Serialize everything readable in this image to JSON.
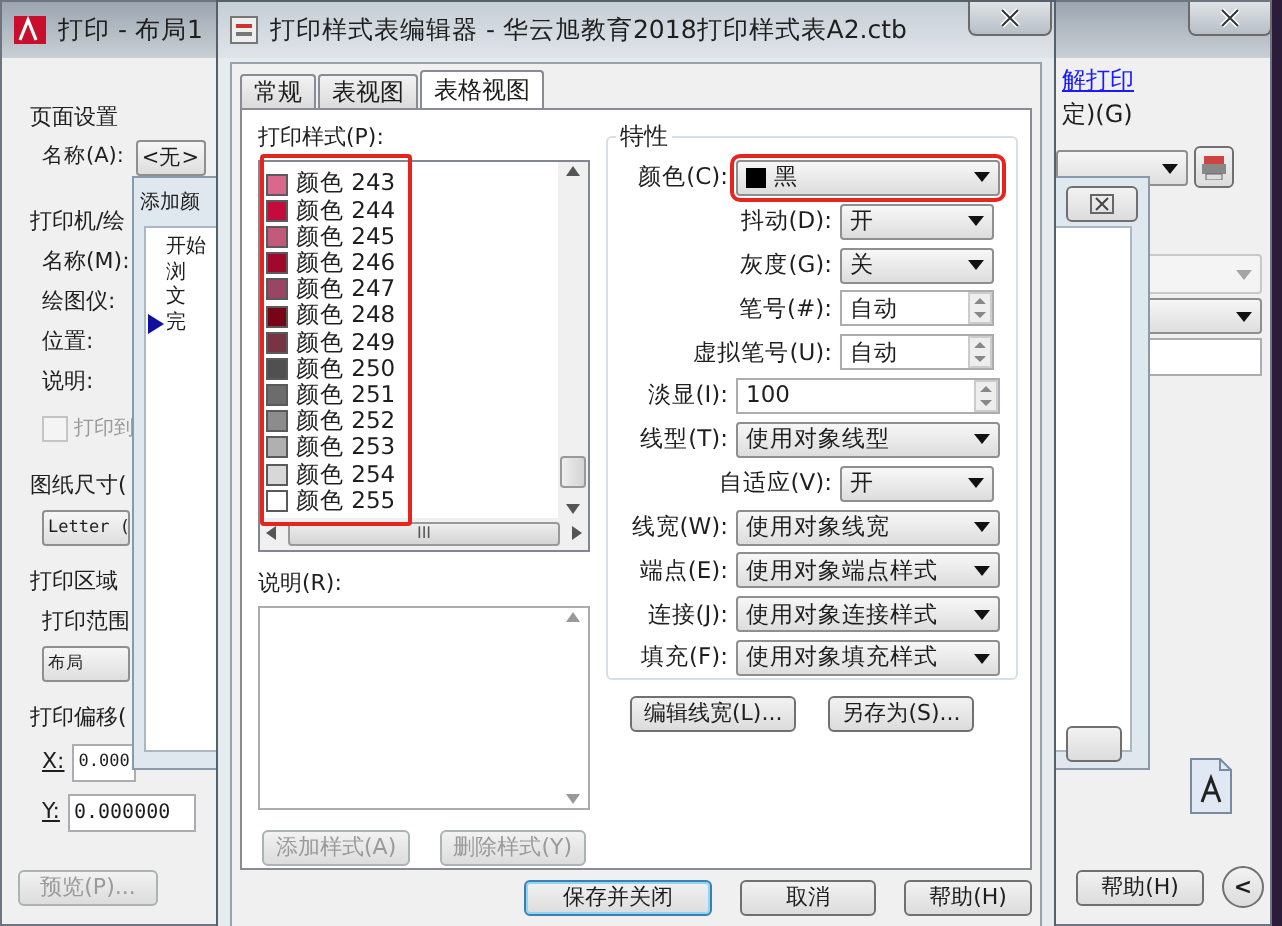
{
  "print_window": {
    "title": "打印 - 布局1",
    "left_items": [
      {
        "kind": "heading",
        "text": "页面设置"
      },
      {
        "kind": "comborow",
        "text": "名称(A):",
        "value": "<无>"
      },
      {
        "kind": "heading",
        "text": "打印机/绘"
      },
      {
        "kind": "label",
        "text": "名称(M):"
      },
      {
        "kind": "label",
        "text": "绘图仪:"
      },
      {
        "kind": "label",
        "text": "位置:"
      },
      {
        "kind": "label",
        "text": "说明:"
      },
      {
        "kind": "checkbox",
        "text": "打印到",
        "checked": false,
        "disabled": true
      },
      {
        "kind": "heading",
        "text": "图纸尺寸("
      },
      {
        "kind": "combo",
        "value": "Letter ("
      },
      {
        "kind": "heading",
        "text": "打印区域"
      },
      {
        "kind": "label",
        "text": "打印范围"
      },
      {
        "kind": "combo",
        "value": "布局"
      },
      {
        "kind": "heading",
        "text": "打印偏移("
      },
      {
        "kind": "field",
        "text": "X:",
        "value": "0.000"
      },
      {
        "kind": "field",
        "text": "Y:",
        "value": "0.000000"
      }
    ],
    "preview_button": {
      "label": "预览(P)...",
      "disabled": true
    },
    "link": "解打印",
    "fragment": "定)(G)",
    "help_button": "帮助(H)",
    "collapse_button": "<"
  },
  "add_dialog": {
    "title": "添加颜",
    "steps": [
      {
        "text": "开始",
        "selected": false
      },
      {
        "text": "浏",
        "selected": false
      },
      {
        "text": "文",
        "selected": false
      },
      {
        "text": "完",
        "selected": true
      }
    ]
  },
  "editor": {
    "title": "打印样式表编辑器 - 华云旭教育2018打印样式表A2.ctb",
    "tabs": [
      {
        "label": "常规",
        "selected": false
      },
      {
        "label": "表视图",
        "selected": false
      },
      {
        "label": "表格视图",
        "selected": true
      }
    ],
    "styles_label": "打印样式(P):",
    "styles_highlighted": true,
    "styles": [
      {
        "label": "颜色 243",
        "color": "#d9688c"
      },
      {
        "label": "颜色 244",
        "color": "#c40c3c"
      },
      {
        "label": "颜色 245",
        "color": "#c45a7a"
      },
      {
        "label": "颜色 246",
        "color": "#a2082c"
      },
      {
        "label": "颜色 247",
        "color": "#9c4464"
      },
      {
        "label": "颜色 248",
        "color": "#780418"
      },
      {
        "label": "颜色 249",
        "color": "#783444"
      },
      {
        "label": "颜色 250",
        "color": "#505050"
      },
      {
        "label": "颜色 251",
        "color": "#6c6c6c"
      },
      {
        "label": "颜色 252",
        "color": "#8c8c8c"
      },
      {
        "label": "颜色 253",
        "color": "#b0b0b0"
      },
      {
        "label": "颜色 254",
        "color": "#d8d8d8"
      },
      {
        "label": "颜色 255",
        "color": "#ffffff"
      }
    ],
    "hscroll_grip": "III",
    "description_label": "说明(R):",
    "add_style_button": "添加样式(A)",
    "delete_style_button": "删除样式(Y)",
    "properties_heading": "特性",
    "properties": [
      {
        "kind": "color",
        "label": "颜色(C):",
        "value": "黑",
        "color": "#000000",
        "highlighted": true
      },
      {
        "kind": "dropdown",
        "label": "抖动(D):",
        "value": "开"
      },
      {
        "kind": "dropdown",
        "label": "灰度(G):",
        "value": "关"
      },
      {
        "kind": "spinner",
        "label": "笔号(#):",
        "value": "自动"
      },
      {
        "kind": "spinner",
        "label": "虚拟笔号(U):",
        "value": "自动"
      },
      {
        "kind": "widespinner",
        "label": "淡显(I):",
        "value": "100"
      },
      {
        "kind": "widedropdown",
        "label": "线型(T):",
        "value": "使用对象线型"
      },
      {
        "kind": "dropdown",
        "label": "自适应(V):",
        "value": "开"
      },
      {
        "kind": "widedropdown",
        "label": "线宽(W):",
        "value": "使用对象线宽"
      },
      {
        "kind": "widedropdown",
        "label": "端点(E):",
        "value": "使用对象端点样式"
      },
      {
        "kind": "widedropdown",
        "label": "连接(J):",
        "value": "使用对象连接样式"
      },
      {
        "kind": "widedropdown",
        "label": "填充(F):",
        "value": "使用对象填充样式"
      }
    ],
    "edit_lineweights_button": "编辑线宽(L)...",
    "save_as_button": "另存为(S)...",
    "footer_buttons": [
      "保存并关闭",
      "取消",
      "帮助(H)"
    ]
  }
}
